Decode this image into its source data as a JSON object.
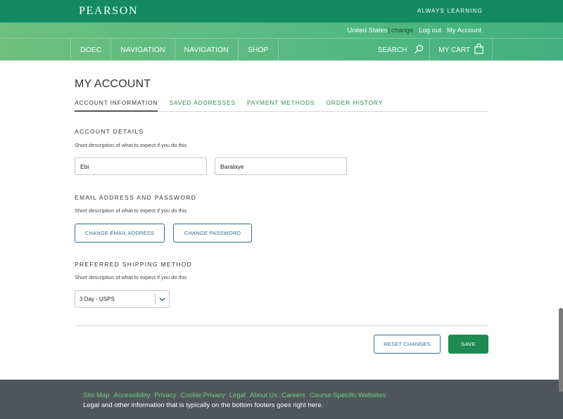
{
  "brand": {
    "logo": "PEARSON",
    "tagline": "ALWAYS LEARNING"
  },
  "utility": {
    "region": "United States",
    "change": "change",
    "separator": "|",
    "logout": "Log out",
    "my_account": "My Account"
  },
  "nav": {
    "items": [
      "DOEC",
      "NAVIGATION",
      "NAVIGATION",
      "SHOP"
    ],
    "search_label": "SEARCH",
    "cart_label": "MY CART"
  },
  "page": {
    "title": "MY ACCOUNT",
    "tabs": [
      {
        "label": "ACCOUNT INFORMATION",
        "active": true
      },
      {
        "label": "SAVED ADDRESSES",
        "active": false
      },
      {
        "label": "PAYMENT METHODS",
        "active": false
      },
      {
        "label": "ORDER HISTORY",
        "active": false
      }
    ]
  },
  "account_details": {
    "title": "ACCOUNT DETAILS",
    "description": "Short description of what to expect if you do this",
    "first_name": "Ebi",
    "last_name": "Baralaye"
  },
  "email_password": {
    "title": "EMAIL ADDRESS AND PASSWORD",
    "description": "Short description of what to expect if you do this",
    "change_email_label": "CHANGE EMAIL ADDRESS",
    "change_password_label": "CHANGE PASSWORD"
  },
  "shipping": {
    "title": "PREFERRED SHIPPING METHOD",
    "description": "Short description of what to expect if you do this",
    "selected": "3 Day - USPS"
  },
  "actions": {
    "reset_label": "RESET CHANGES",
    "save_label": "SAVE"
  },
  "footer": {
    "links": [
      "Site Map",
      "Accessibility",
      "Privacy",
      "Cookie Privacy",
      "Legal",
      "About Us",
      "Careers",
      "Course Specific Websites"
    ],
    "legal": "Legal and other information that is typically on the bottom footers goes right here."
  },
  "colors": {
    "topbar": "#138a62",
    "accent_green": "#2a8e4a",
    "button_blue": "#2d6e97",
    "save_green": "#1e8a54",
    "footer_bg": "#51565c",
    "footer_link": "#6ed17c"
  }
}
